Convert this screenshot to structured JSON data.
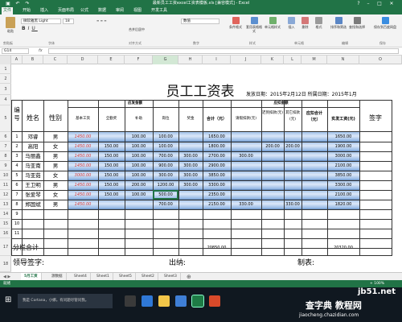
{
  "app": {
    "title": "最新员工工资excel工资表模板.xls [兼容模式] - Excel"
  },
  "ribbon_tabs": [
    "文件",
    "开始",
    "插入",
    "页面布局",
    "公式",
    "数据",
    "审阅",
    "视图",
    "开发工具"
  ],
  "ribbon": {
    "paste": "粘贴",
    "font_name": "微软雅黑 Light",
    "font_size": "18",
    "number_format": "数值",
    "merge_label": "合并后居中",
    "cond_format": "条件格式",
    "table_format": "套用表格格式",
    "cell_styles": "单元格样式",
    "insert": "插入",
    "delete": "删除",
    "format": "格式",
    "sort": "排序和筛选",
    "find": "查找和选择",
    "share": "保存到百度网盘",
    "groups": [
      "剪贴板",
      "字体",
      "对齐方式",
      "数字",
      "样式",
      "单元格",
      "编辑",
      "保存"
    ]
  },
  "formula_bar": {
    "name_box": "G14",
    "fx": "fx"
  },
  "columns": [
    "A",
    "B",
    "C",
    "D",
    "E",
    "F",
    "G",
    "H",
    "I",
    "J",
    "K",
    "L",
    "M",
    "N",
    "O"
  ],
  "rows": [
    "1",
    "2",
    "3",
    "4",
    "5",
    "6",
    "7",
    "8",
    "9",
    "10",
    "11",
    "12",
    "13",
    "14",
    "15",
    "16",
    "17",
    "18",
    "19"
  ],
  "sheet": {
    "title": "员工工资表",
    "issue_date": "发放日期：2015年2月12日 所属日期：2015年1月",
    "headers": {
      "no": "编号",
      "name": "姓名",
      "gender": "性别",
      "earnings": "应发金额",
      "deductions": "应扣金额",
      "base": "基本工资",
      "bonus": "全勤奖",
      "subsidy": "补助",
      "post": "岗位",
      "award": "奖金",
      "subtotal": "合计（元）",
      "leave": "请假扣款(元)",
      "late": "迟到扣款(元)",
      "other": "其它扣款(元)",
      "ded_total": "应扣合计（元）",
      "net": "实发工资(元)",
      "sign": "签字"
    },
    "employees": [
      {
        "no": "1",
        "name": "邓睿",
        "gender": "男",
        "base": "1450.00",
        "bonus": "",
        "subsidy": "100.00",
        "post": "100.00",
        "award": "",
        "subtotal": "1650.00",
        "leave": "",
        "late": "",
        "other": "",
        "ded": "",
        "net": "1650.00"
      },
      {
        "no": "2",
        "name": "高阳",
        "gender": "女",
        "base": "1450.00",
        "bonus": "150.00",
        "subsidy": "100.00",
        "post": "100.00",
        "award": "",
        "subtotal": "1800.00",
        "leave": "",
        "late": "200.00",
        "other": "200.00",
        "ded": "",
        "net": "1900.00"
      },
      {
        "no": "3",
        "name": "马丽鑫",
        "gender": "男",
        "base": "1450.00",
        "bonus": "150.00",
        "subsidy": "100.00",
        "post": "700.00",
        "award": "300.00",
        "subtotal": "2700.00",
        "leave": "300.00",
        "late": "",
        "other": "",
        "ded": "",
        "net": "3000.00"
      },
      {
        "no": "4",
        "name": "马亚南",
        "gender": "男",
        "base": "1450.00",
        "bonus": "150.00",
        "subsidy": "100.00",
        "post": "900.00",
        "award": "300.00",
        "subtotal": "2900.00",
        "leave": "",
        "late": "",
        "other": "",
        "ded": "",
        "net": "2100.00"
      },
      {
        "no": "5",
        "name": "马亚茹",
        "gender": "女",
        "base": "3000.00",
        "bonus": "150.00",
        "subsidy": "100.00",
        "post": "300.00",
        "award": "300.00",
        "subtotal": "3850.00",
        "leave": "",
        "late": "",
        "other": "",
        "ded": "",
        "net": "3850.00"
      },
      {
        "no": "6",
        "name": "王卫明",
        "gender": "男",
        "base": "1450.00",
        "bonus": "150.00",
        "subsidy": "200.00",
        "post": "1200.00",
        "award": "300.00",
        "subtotal": "3300.00",
        "leave": "",
        "late": "",
        "other": "",
        "ded": "",
        "net": "3300.00"
      },
      {
        "no": "7",
        "name": "张爱琴",
        "gender": "女",
        "base": "1450.00",
        "bonus": "150.00",
        "subsidy": "100.00",
        "post": "500.00",
        "award": "",
        "subtotal": "2350.00",
        "leave": "",
        "late": "",
        "other": "",
        "ded": "",
        "net": "2100.00"
      },
      {
        "no": "8",
        "name": "郑国斌",
        "gender": "男",
        "base": "1450.00",
        "bonus": "",
        "subsidy": "",
        "post": "700.00",
        "award": "",
        "subtotal": "2150.00",
        "leave": "330.00",
        "late": "",
        "other": "330.00",
        "ded": "",
        "net": "1820.00"
      }
    ],
    "empty_rows": [
      "9",
      "10",
      "11"
    ],
    "total_label": "分栏合计",
    "total_subtotal": "20850.00",
    "total_net": "20320.00",
    "sign_leader": "领导签字:",
    "sign_cashier": "出纳:",
    "sign_maker": "制表:"
  },
  "sheet_tabs": [
    "5月工资",
    "源数据",
    "Sheet4",
    "Sheet1",
    "Sheet5",
    "Sheet2",
    "Sheet3"
  ],
  "status": {
    "left": "就绪",
    "zoom": "+ 100%"
  },
  "taskbar": {
    "search": "我是 Cortana，小娜。有问题尽管问我。"
  },
  "watermark": {
    "site": "jb51.net",
    "cn": "查字典 教程网",
    "url": "jiaocheng.chazidian.com"
  },
  "colors": {
    "excel_green": "#217346",
    "band": "#a9c7ee",
    "red_text": "#d43a3a"
  }
}
